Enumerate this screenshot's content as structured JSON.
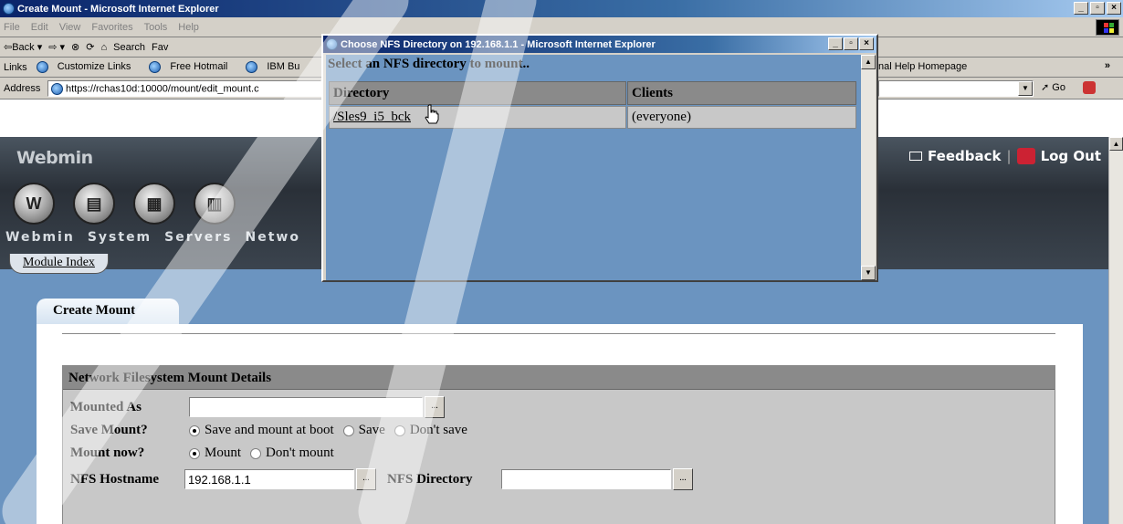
{
  "main_window": {
    "title": "Create Mount - Microsoft Internet Explorer",
    "menu": [
      "File",
      "Edit",
      "View",
      "Favorites",
      "Tools",
      "Help"
    ],
    "toolbar": [
      "⇦Back ▾",
      "⇨ ▾",
      "⊗",
      "⟳",
      "⌂",
      "Search",
      "Fav"
    ],
    "links_label": "Links",
    "links": [
      "Customize Links",
      "Free Hotmail",
      "IBM Bu"
    ],
    "links_right": "nal Help Homepage",
    "address_label": "Address",
    "address_value": "https://rchas10d:10000/mount/edit_mount.c",
    "go_label": "Go",
    "more_chevron": "»"
  },
  "webmin": {
    "logo": "Webmin",
    "feedback_label": "Feedback",
    "logout_label": "Log Out",
    "separator": "|",
    "nav": [
      {
        "label": "Webmin",
        "icon": "webmin-icon",
        "glyph": "W"
      },
      {
        "label": "System",
        "icon": "system-icon",
        "glyph": "▤"
      },
      {
        "label": "Servers",
        "icon": "servers-icon",
        "glyph": "▦"
      },
      {
        "label": "Netwo",
        "icon": "network-icon",
        "glyph": "▥"
      }
    ],
    "module_index": "Module Index",
    "tab_title": "Create Mount"
  },
  "form": {
    "section_title": "Network Filesystem Mount Details",
    "mounted_as_label": "Mounted As",
    "mounted_as_value": "",
    "save_mount_label": "Save Mount?",
    "save_options": [
      "Save and mount at boot",
      "Save",
      "Don't save"
    ],
    "save_selected": 0,
    "mount_now_label": "Mount now?",
    "mount_options": [
      "Mount",
      "Don't mount"
    ],
    "mount_selected": 0,
    "nfs_hostname_label": "NFS Hostname",
    "nfs_hostname_value": "192.168.1.1",
    "nfs_directory_label": "NFS Directory",
    "nfs_directory_value": "",
    "browse_label": "..."
  },
  "popup": {
    "title": "Choose NFS Directory on 192.168.1.1 - Microsoft Internet Explorer",
    "heading": "Select an NFS directory to mount..",
    "columns": [
      "Directory",
      "Clients"
    ],
    "rows": [
      {
        "directory": "/Sles9_i5_bck",
        "clients": "(everyone)"
      }
    ]
  },
  "colors": {
    "titlebar": "#0a246a",
    "page_bg": "#6b94c0",
    "chrome": "#d4d0c8",
    "table_header": "#8a8a8a",
    "table_cell": "#c8c8c8"
  }
}
